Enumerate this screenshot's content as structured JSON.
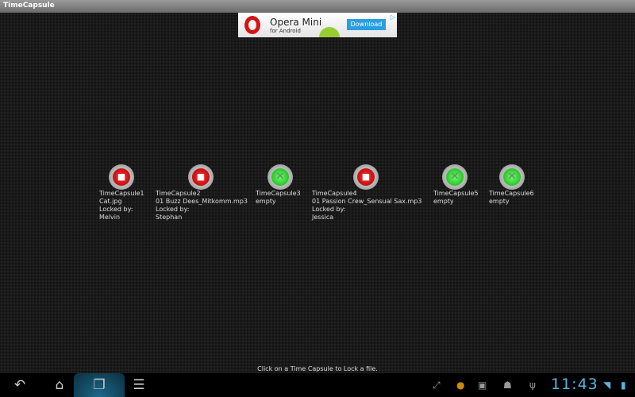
{
  "app": {
    "title": "TimeCapsule"
  },
  "ad": {
    "title": "Opera Mini",
    "subtitle": "for Android",
    "button": "Download",
    "adchoices": "▷"
  },
  "capsules": [
    {
      "name": "TimeCapsule1",
      "file": "Cat.jpg",
      "locked_label": "Locked by:",
      "user": "Melvin",
      "state": "locked"
    },
    {
      "name": "TimeCapsule2",
      "file": "01 Buzz Dees_Mitkomm.mp3",
      "locked_label": "Locked by:",
      "user": "Stephan",
      "state": "locked"
    },
    {
      "name": "TimeCapsule3",
      "file": "empty",
      "state": "empty"
    },
    {
      "name": "TimeCapsule4",
      "file": "01 Passion Crew_Sensual Sax.mp3",
      "locked_label": "Locked by:",
      "user": "Jessica",
      "state": "locked"
    },
    {
      "name": "TimeCapsule5",
      "file": "empty",
      "state": "empty"
    },
    {
      "name": "TimeCapsule6",
      "file": "empty",
      "state": "empty"
    }
  ],
  "status_message": "Click on a Time Capsule to Lock a file.",
  "navbar": {
    "back": "↶",
    "home": "⌂",
    "recent": "❐",
    "menu": "☰"
  },
  "statusbar": {
    "clock": "11:43",
    "icons": {
      "fullscreen": "⤢",
      "notify": "●",
      "screenshot": "▣",
      "android": "☗",
      "usb": "ψ",
      "wifi": "◥",
      "battery": "▮"
    }
  }
}
